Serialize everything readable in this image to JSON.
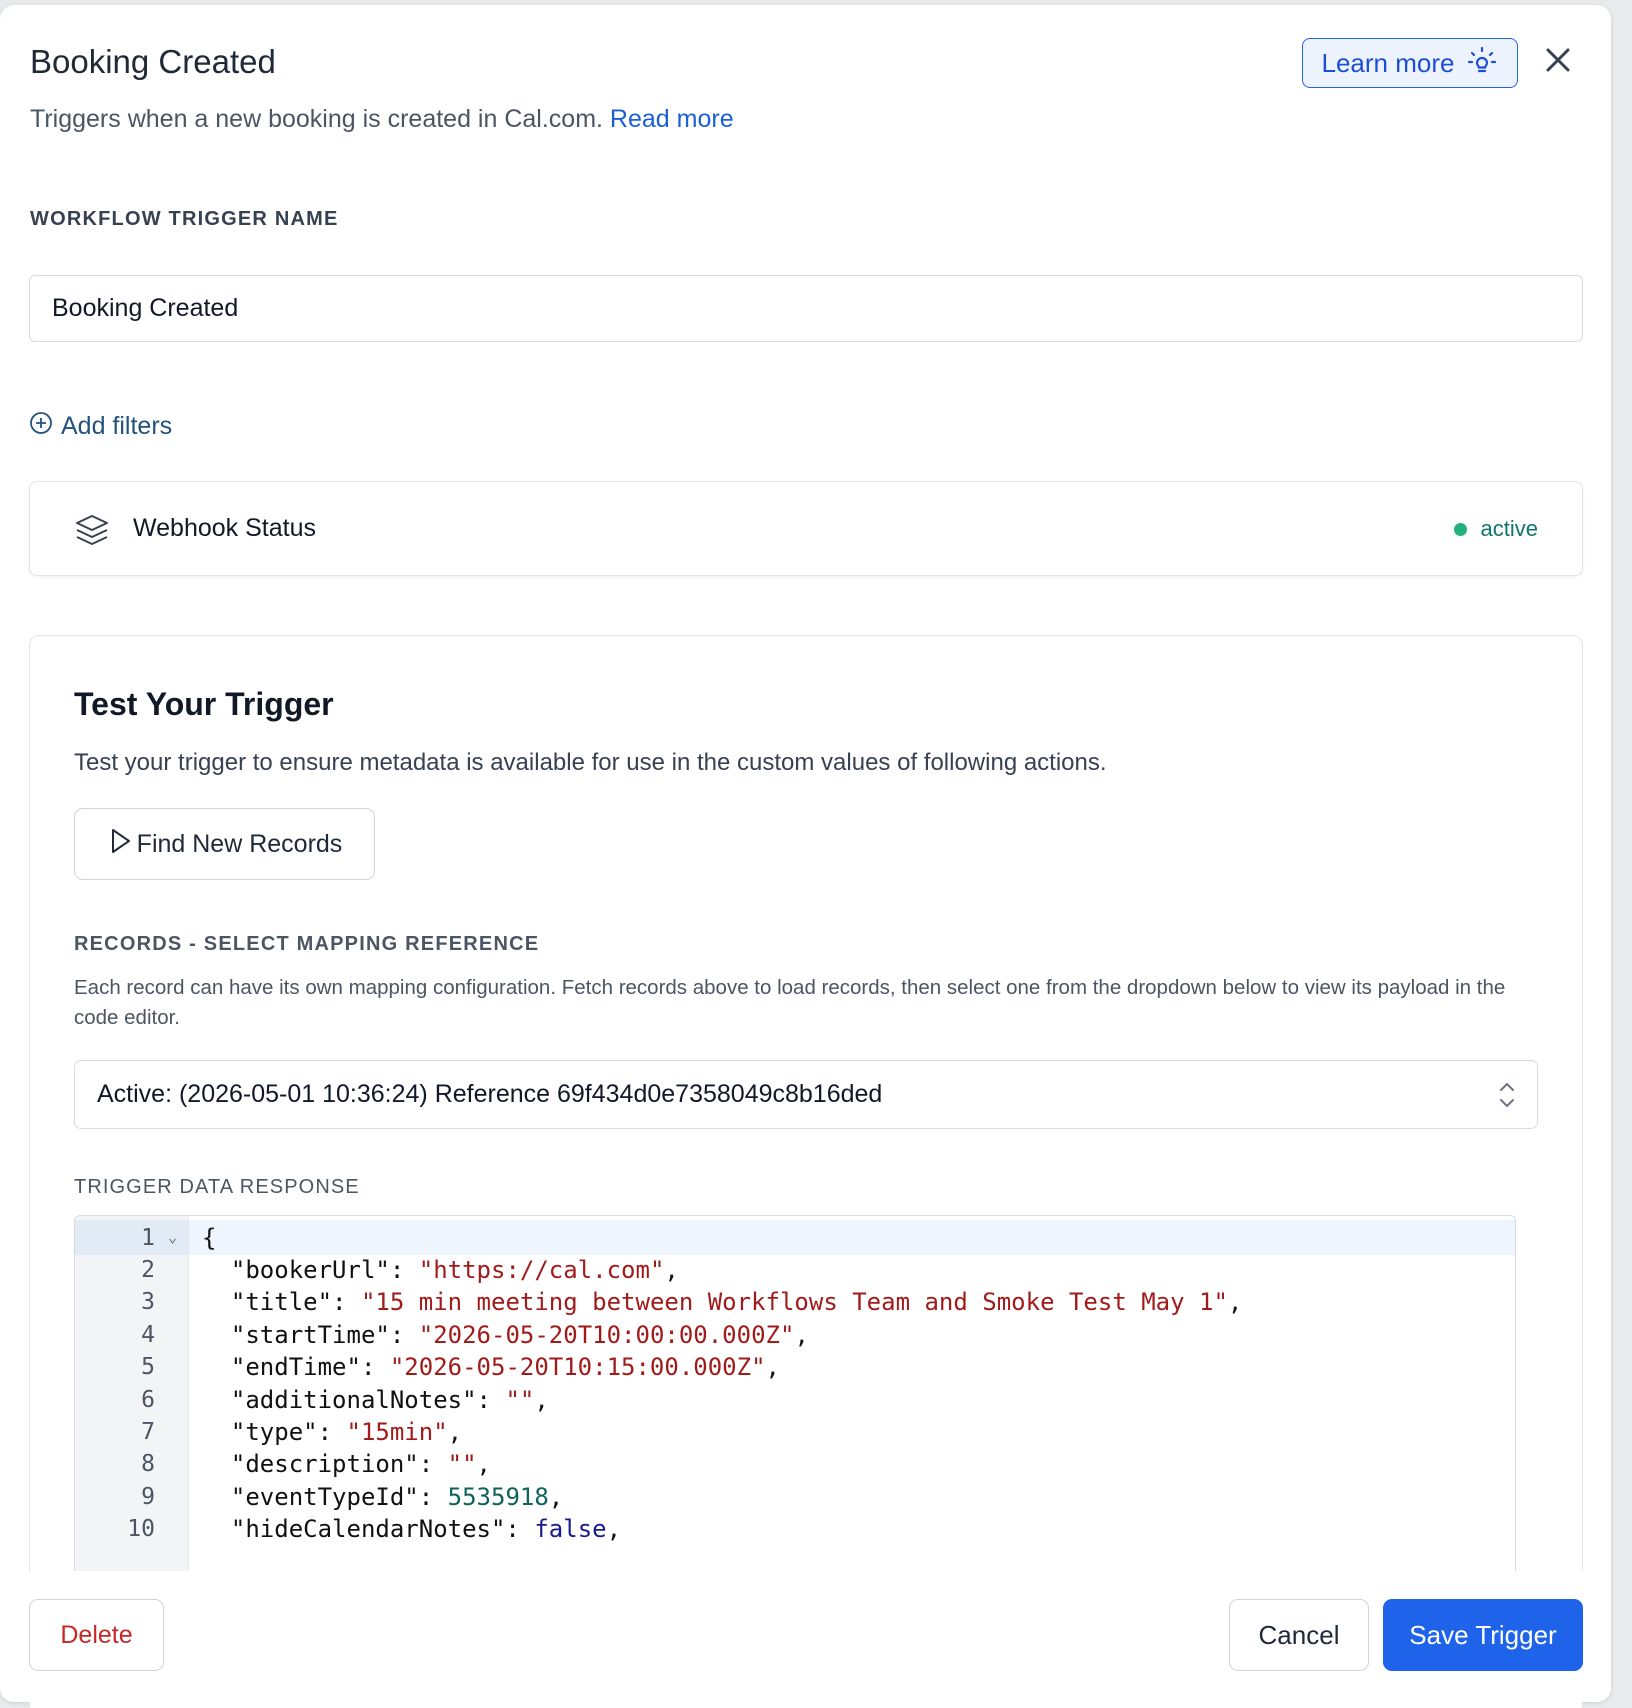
{
  "header": {
    "title": "Booking Created",
    "subtitle": "Triggers when a new booking is created in Cal.com.",
    "read_more": "Read more",
    "learn_more": "Learn more",
    "learn_icon": "lightbulb-icon",
    "close_icon": "close-icon"
  },
  "trigger_name": {
    "label": "WORKFLOW TRIGGER NAME",
    "value": "Booking Created"
  },
  "filters": {
    "add_label": "Add filters",
    "icon": "plus-circle-icon"
  },
  "webhook": {
    "icon": "layers-icon",
    "label": "Webhook Status",
    "status": "active",
    "status_color": "#22b07d"
  },
  "test": {
    "title": "Test Your Trigger",
    "description": "Test your trigger to ensure metadata is available for use in the custom values of following actions.",
    "find_button": "Find New Records",
    "records_label": "RECORDS - SELECT MAPPING REFERENCE",
    "records_description": "Each record can have its own mapping configuration. Fetch records above to load records, then select one from the dropdown below to view its payload in the code editor.",
    "selected_record": "Active: (2026-05-01 10:36:24) Reference 69f434d0e7358049c8b16ded",
    "response_label": "TRIGGER DATA RESPONSE"
  },
  "code": {
    "lines": [
      {
        "n": "1",
        "segs": [
          [
            "p",
            "{"
          ]
        ]
      },
      {
        "n": "2",
        "segs": [
          [
            "p",
            "  \"bookerUrl\": "
          ],
          [
            "s",
            "\"https://cal.com\""
          ],
          [
            "p",
            ","
          ]
        ]
      },
      {
        "n": "3",
        "segs": [
          [
            "p",
            "  \"title\": "
          ],
          [
            "s",
            "\"15 min meeting between Workflows Team and Smoke Test May 1\""
          ],
          [
            "p",
            ","
          ]
        ]
      },
      {
        "n": "4",
        "segs": [
          [
            "p",
            "  \"startTime\": "
          ],
          [
            "s",
            "\"2026-05-20T10:00:00.000Z\""
          ],
          [
            "p",
            ","
          ]
        ]
      },
      {
        "n": "5",
        "segs": [
          [
            "p",
            "  \"endTime\": "
          ],
          [
            "s",
            "\"2026-05-20T10:15:00.000Z\""
          ],
          [
            "p",
            ","
          ]
        ]
      },
      {
        "n": "6",
        "segs": [
          [
            "p",
            "  \"additionalNotes\": "
          ],
          [
            "s",
            "\"\""
          ],
          [
            "p",
            ","
          ]
        ]
      },
      {
        "n": "7",
        "segs": [
          [
            "p",
            "  \"type\": "
          ],
          [
            "s",
            "\"15min\""
          ],
          [
            "p",
            ","
          ]
        ]
      },
      {
        "n": "8",
        "segs": [
          [
            "p",
            "  \"description\": "
          ],
          [
            "s",
            "\"\""
          ],
          [
            "p",
            ","
          ]
        ]
      },
      {
        "n": "9",
        "segs": [
          [
            "p",
            "  \"eventTypeId\": "
          ],
          [
            "n",
            "5535918"
          ],
          [
            "p",
            ","
          ]
        ]
      },
      {
        "n": "10",
        "segs": [
          [
            "p",
            "  \"hideCalendarNotes\": "
          ],
          [
            "b",
            "false"
          ],
          [
            "p",
            ","
          ]
        ]
      }
    ]
  },
  "footer": {
    "delete": "Delete",
    "cancel": "Cancel",
    "save": "Save Trigger"
  }
}
